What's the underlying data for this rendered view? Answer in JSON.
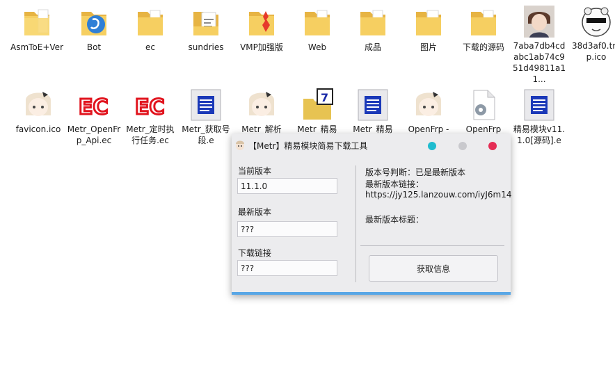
{
  "desktop": {
    "icons": [
      {
        "label": "AsmToE+Ver",
        "icon": "folder-icon"
      },
      {
        "label": "Bot",
        "icon": "folder-icon"
      },
      {
        "label": "ec",
        "icon": "folder-icon"
      },
      {
        "label": "sundries",
        "icon": "folder-icon"
      },
      {
        "label": "VMP加强版",
        "icon": "folder-icon"
      },
      {
        "label": "Web",
        "icon": "folder-icon"
      },
      {
        "label": "成品",
        "icon": "folder-icon"
      },
      {
        "label": "图片",
        "icon": "folder-icon"
      },
      {
        "label": "下载的源码",
        "icon": "folder-icon"
      },
      {
        "label": "7aba7db4cdabc1ab74c951d49811a11...",
        "icon": "image-thumbnail-icon"
      },
      {
        "label": "38d3af0.tmp.ico",
        "icon": "image-thumbnail-icon"
      },
      {
        "label": "favicon.ico",
        "icon": "anime-avatar-icon"
      },
      {
        "label": "Metr_OpenFrp_Api.ec",
        "icon": "ec-file-icon"
      },
      {
        "label": "Metr_定时执行任务.ec",
        "icon": "ec-file-icon"
      },
      {
        "label": "Metr_获取号段.e",
        "icon": "e-source-icon"
      },
      {
        "label": "Metr_解析",
        "icon": "anime-avatar-icon"
      },
      {
        "label": "Metr_精易",
        "icon": "e-package-icon"
      },
      {
        "label": "Metr_精易",
        "icon": "e-source-icon"
      },
      {
        "label": "OpenFrp -",
        "icon": "anime-avatar-icon"
      },
      {
        "label": "OpenFrp",
        "icon": "gear-file-icon"
      },
      {
        "label": "精易模块v11.1.0[源码].e",
        "icon": "e-source-icon"
      }
    ]
  },
  "dialog": {
    "title": "【Metr】精易模块简易下载工具",
    "current_version_label": "当前版本",
    "current_version_value": "11.1.0",
    "latest_version_label": "最新版本",
    "latest_version_value": "???",
    "download_link_label": "下载链接",
    "download_link_value": "???",
    "info_version_check": "版本号判断：已是最新版本",
    "info_latest_link_label": "最新版本链接：",
    "info_latest_link_url": "https://jy125.lanzouw.com/iyJ6m14",
    "info_latest_title_label": "最新版本标题：",
    "fetch_button_label": "获取信息"
  },
  "colors": {
    "minimize": "#1fbccf",
    "maximize": "#c9c9cd",
    "close": "#e52d55",
    "accent_bar": "#59a7e6",
    "folder": "#f6cf61"
  }
}
